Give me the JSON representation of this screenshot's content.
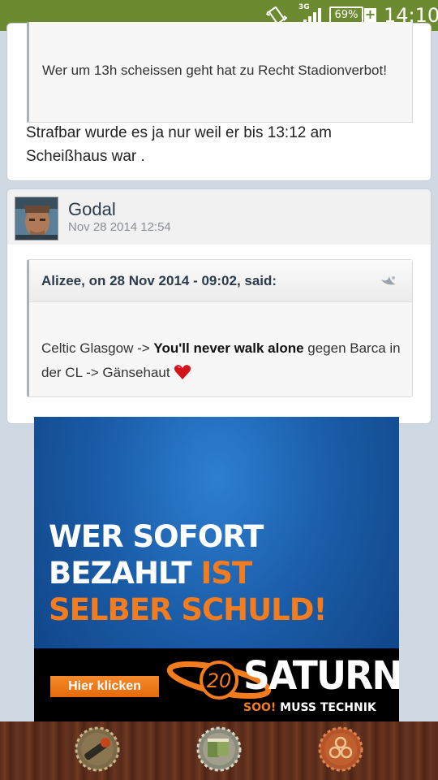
{
  "status_bar": {
    "network": "3G",
    "battery": "69%",
    "time": "14:10"
  },
  "post1": {
    "quote_text": "Wer um 13h scheissen geht hat zu Recht Stadionverbot!",
    "body": "Strafbar wurde es ja nur weil er bis 13:12 am Scheißhaus war ."
  },
  "post2": {
    "author": "Godal",
    "date": "Nov 28 2014 12:54",
    "quote": {
      "citation": "Alizee, on 28 Nov 2014 - 09:02, said:",
      "text_before": "Celtic Glasgow -> ",
      "text_bold": "You'll never walk alone",
      "text_after": " gegen Barca in der CL -> Gänsehaut"
    }
  },
  "ad": {
    "line1": "WER SOFORT",
    "line2_white": "BEZAHLT ",
    "line2_orange": "IST",
    "line3": "SELBER SCHULD!",
    "cta": "Hier klicken",
    "brand": "SATURN",
    "slogan_orange": "SOO!",
    "slogan_white": " MUSS TECHNIK",
    "logo_number": "20"
  },
  "colors": {
    "status_bar": "#6c8a2f",
    "ad_orange": "#f47c1c",
    "ad_blue": "#1a5ca8"
  },
  "bottom_nav": {
    "items": [
      "bottle-opener-icon",
      "beer-mugs-icon",
      "triskele-icon"
    ]
  }
}
